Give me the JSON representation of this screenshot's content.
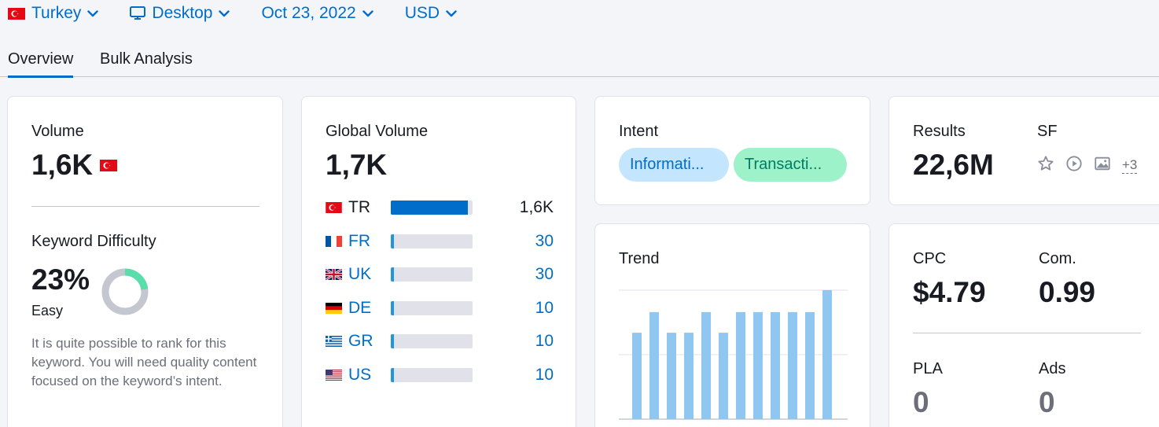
{
  "filters": {
    "country": "Turkey",
    "device": "Desktop",
    "date": "Oct 23, 2022",
    "currency": "USD"
  },
  "tabs": [
    {
      "label": "Overview",
      "active": true
    },
    {
      "label": "Bulk Analysis",
      "active": false
    }
  ],
  "volume": {
    "label": "Volume",
    "value": "1,6K"
  },
  "keyword_difficulty": {
    "label": "Keyword Difficulty",
    "value": "23%",
    "percent": 23,
    "level": "Easy",
    "description": "It is quite possible to rank for this keyword. You will need quality content focused on the keyword’s intent."
  },
  "global_volume": {
    "label": "Global Volume",
    "value": "1,7K",
    "countries": [
      {
        "code": "TR",
        "value": "1,6K",
        "share": 0.94,
        "highlight": true
      },
      {
        "code": "FR",
        "value": "30",
        "share": 0.03,
        "highlight": false
      },
      {
        "code": "UK",
        "value": "30",
        "share": 0.03,
        "highlight": false
      },
      {
        "code": "DE",
        "value": "10",
        "share": 0.03,
        "highlight": false
      },
      {
        "code": "GR",
        "value": "10",
        "share": 0.03,
        "highlight": false
      },
      {
        "code": "US",
        "value": "10",
        "share": 0.03,
        "highlight": false
      }
    ]
  },
  "intent": {
    "label": "Intent",
    "pills": [
      {
        "text": "Informati...",
        "bg": "#c4e5fe",
        "color": "#006dca"
      },
      {
        "text": "Transacti...",
        "bg": "#9ef2c9",
        "color": "#007c65"
      }
    ]
  },
  "results": {
    "label": "Results",
    "value": "22,6M",
    "sf_label": "SF",
    "sf_more": "+3"
  },
  "trend": {
    "label": "Trend",
    "bars": [
      0.67,
      0.83,
      0.67,
      0.67,
      0.83,
      0.67,
      0.83,
      0.83,
      0.83,
      0.83,
      0.83,
      1.0
    ]
  },
  "cpc": {
    "cpc_label": "CPC",
    "cpc_value": "$4.79",
    "com_label": "Com.",
    "com_value": "0.99",
    "pla_label": "PLA",
    "pla_value": "0",
    "ads_label": "Ads",
    "ads_value": "0"
  },
  "colors": {
    "link": "#006dca",
    "bar_primary": "#006dca",
    "bar_secondary": "#2196d9",
    "trend_bar": "#8fc7f0",
    "kd_easy": "#59ddaa",
    "kd_track": "#c4c7cf"
  }
}
